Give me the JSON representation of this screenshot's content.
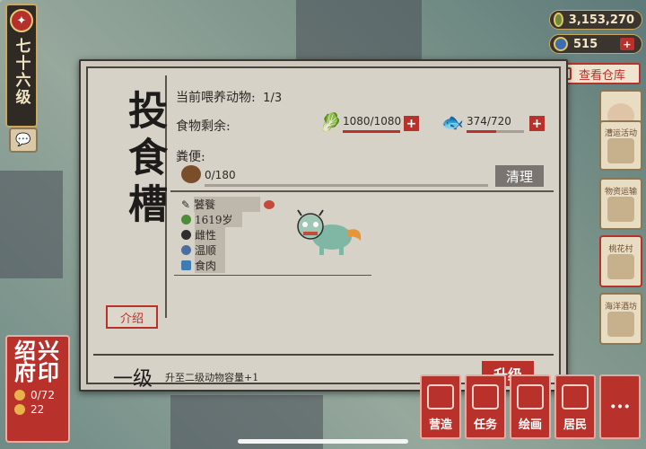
{
  "player": {
    "level_text": "七十六级"
  },
  "currency": {
    "coins": "3,153,270",
    "gems": "515"
  },
  "top": {
    "warehouse_label": "查看仓库"
  },
  "panel": {
    "title": "投食槽",
    "intro_label": "介绍",
    "animals_label": "当前喂养动物:",
    "animals_value": "1/3",
    "food_label": "食物剩余:",
    "food1": {
      "text": "1080/1080",
      "fill": 1.0
    },
    "food2": {
      "text": "374/720",
      "fill": 0.52
    },
    "manure_label": "粪便:",
    "manure": {
      "text": "0/180",
      "fill": 0.0
    },
    "clean_label": "清理",
    "animal": {
      "name": "饕餮",
      "age": "1619岁",
      "sex": "雌性",
      "temper": "温顺",
      "diet": "食肉"
    },
    "level_label": "一级",
    "level_desc": "升至二级动物容量+1",
    "upgrade_label": "升级"
  },
  "seal": {
    "title": "绍兴府印",
    "stat1": "0/72",
    "stat2": "22"
  },
  "bottom_menu": [
    "营造",
    "任务",
    "绘画",
    "居民"
  ],
  "side_buttons": [
    "漕运活动",
    "物资运输",
    "桃花村",
    "海洋酒坊"
  ],
  "colors": {
    "accent_red": "#b8312b",
    "panel": "#d7d2c7",
    "gold": "#c9a862"
  }
}
